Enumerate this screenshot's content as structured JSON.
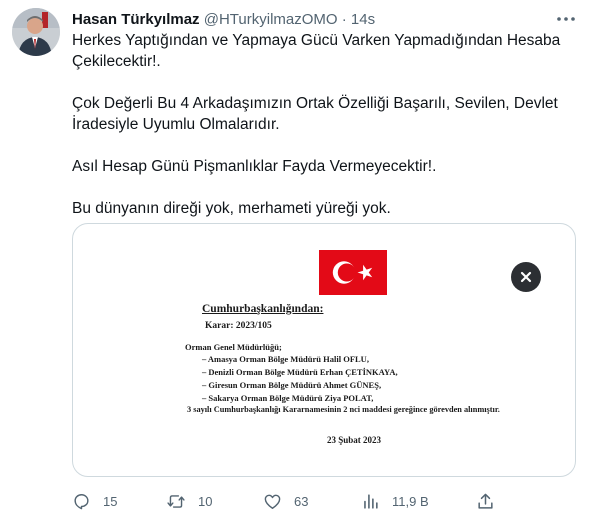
{
  "tweet": {
    "author_name": "Hasan Türkyılmaz",
    "handle": "@HTurkyilmazOMO",
    "separator": "·",
    "time": "14s",
    "paragraphs": [
      "Herkes Yaptığından ve Yapmaya Gücü Varken Yapmadığından Hesaba Çekilecektir!.",
      "Çok Değerli Bu 4 Arkadaşımızın Ortak Özelliği Başarılı, Sevilen, Devlet İradesiyle Uyumlu Olmalarıdır.",
      "Asıl Hesap Günü Pişmanlıklar Fayda Vermeyecektir!.",
      "Bu dünyanın direği yok, merhameti yüreği yok."
    ]
  },
  "document": {
    "heading": "Cumhurbaşkanlığından:",
    "karar": "Karar: 2023/105",
    "department": "Orman Genel Müdürlüğü;",
    "items": [
      "–  Amasya Orman Bölge Müdürü Halil OFLU,",
      "–  Denizli Orman Bölge Müdürü Erhan ÇETİNKAYA,",
      "–  Giresun Orman Bölge Müdürü Ahmet GÜNEŞ,",
      "–  Sakarya Orman Bölge Müdürü Ziya POLAT,"
    ],
    "decree_line": "3 sayılı Cumhurbaşkanlığı Kararnamesinin 2 nci maddesi gereğince görevden alınmıştır.",
    "date": "23 Şubat 2023"
  },
  "actions": {
    "replies": "15",
    "retweets": "10",
    "likes": "63",
    "views": "11,9 B"
  },
  "colors": {
    "text": "#0f1419",
    "secondary": "#536471",
    "border": "#cfd9de",
    "flag_red": "#e30a17"
  }
}
